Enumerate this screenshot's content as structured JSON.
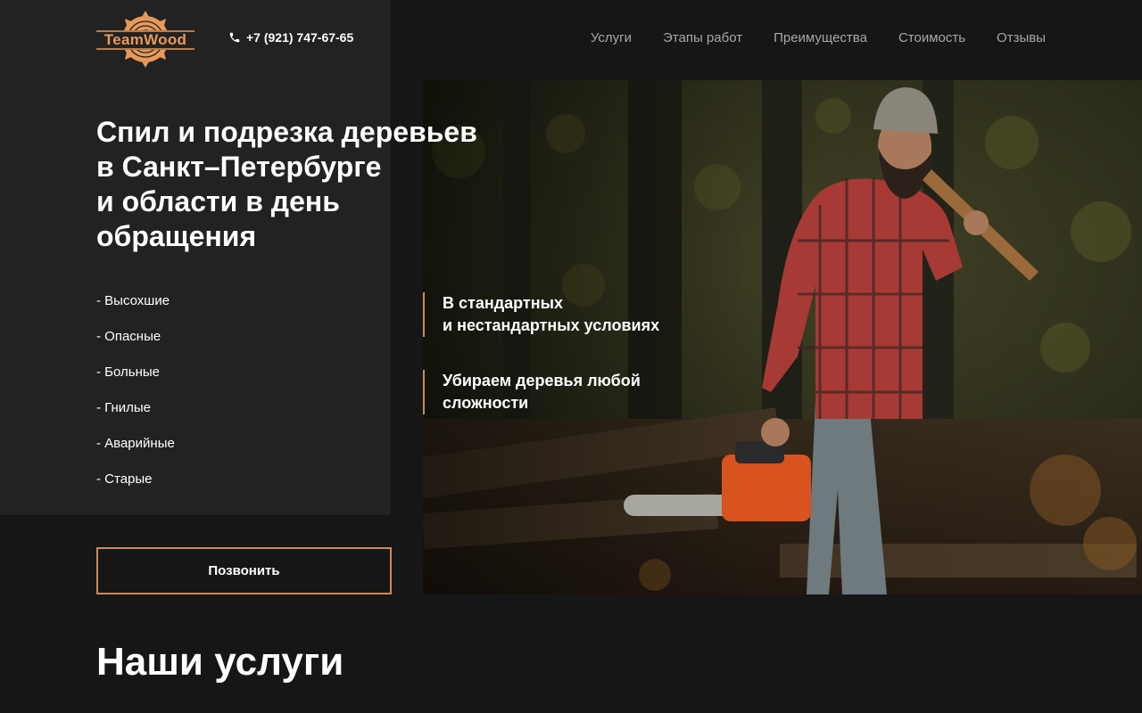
{
  "header": {
    "logo_text": "TeamWood",
    "phone": "+7 (921) 747-67-65",
    "nav": [
      "Услуги",
      "Этапы работ",
      "Преимущества",
      "Стоимость",
      "Отзывы"
    ]
  },
  "hero": {
    "title": "Спил и подрезка деревьев\nв Санкт–Петербурге\nи области в день\nобращения",
    "list": [
      "- Высохшие",
      "- Опасные",
      "- Больные",
      "- Гнилые",
      "- Аварийные",
      "- Старые"
    ],
    "features": [
      "В стандартных\nи нестандартных условиях",
      "Убираем деревья любой\nсложности"
    ],
    "call_button": "Позвонить"
  },
  "services": {
    "heading": "Наши услуги"
  },
  "colors": {
    "accent": "#c98b5a",
    "logo": "#e8995a",
    "background": "#161616",
    "panel": "#222222"
  }
}
